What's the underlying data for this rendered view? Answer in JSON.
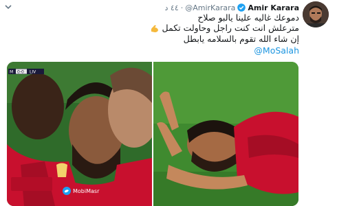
{
  "tweet": {
    "author_name": "Amir Karara",
    "handle": "@AmirKarara",
    "time": "٤٤ د",
    "lines": [
      "دموعك غاليه علينا يالبو صلاح",
      "مترعلش انت كنت راجل وحاولت تكمل",
      "إن شاء الله تقوم بالسلامه يابطل"
    ],
    "mention": "@MoSalah"
  },
  "media": {
    "left_photo": {
      "scoreboard_left": "M",
      "scoreboard_score": "0-0",
      "scoreboard_right": "LIV",
      "watermark": "MobiMasr"
    }
  },
  "icons": {
    "verified": "verified-badge-icon",
    "chevron": "chevron-down-icon",
    "emoji": "flexed-biceps-emoji",
    "bird": "twitter-bird-icon"
  },
  "colors": {
    "accent": "#1b95e0",
    "liverpool_red": "#c8102e",
    "pitch_green": "#3f8a2f"
  }
}
